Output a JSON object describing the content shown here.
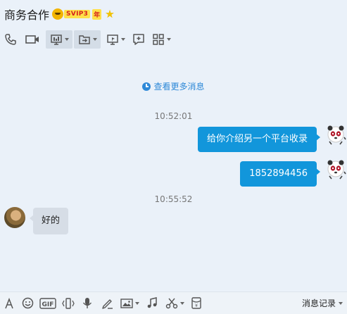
{
  "header": {
    "title": "商务合作",
    "vip_label": "SVIP3",
    "vip_year_label": "年"
  },
  "toolbar": {
    "items": [
      {
        "name": "phone-icon"
      },
      {
        "name": "video-icon"
      },
      {
        "name": "screen-share-icon",
        "active": true,
        "dropdown": true
      },
      {
        "name": "send-file-icon",
        "active": true,
        "dropdown": true
      },
      {
        "name": "remote-desktop-icon",
        "dropdown": true
      },
      {
        "name": "add-app-icon"
      },
      {
        "name": "apps-grid-icon",
        "dropdown": true
      }
    ]
  },
  "chat": {
    "more_messages": "查看更多消息",
    "accent": "#1296db",
    "messages": [
      {
        "time": "10:52:01"
      },
      {
        "direction": "out",
        "text": "给你介绍另一个平台收录"
      },
      {
        "direction": "out",
        "text": "1852894456"
      },
      {
        "time": "10:55:52"
      },
      {
        "direction": "in",
        "text": "好的"
      }
    ]
  },
  "bottom_bar": {
    "tools": [
      "font-icon",
      "emoji-icon",
      "gif-icon",
      "shake-icon",
      "voice-icon",
      "handwrite-icon",
      "image-icon",
      "music-icon",
      "screenshot-icon",
      "red-packet-icon"
    ],
    "history_label": "消息记录"
  }
}
